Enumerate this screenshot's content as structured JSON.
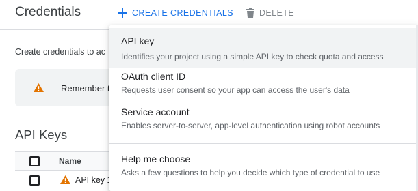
{
  "header": {
    "title": "Credentials",
    "create_label": "CREATE CREDENTIALS",
    "delete_label": "DELETE"
  },
  "intro": {
    "text": "Create credentials to ac"
  },
  "banner": {
    "text": "Remember t"
  },
  "api_keys": {
    "title": "API Keys",
    "column_name": "Name",
    "rows": [
      {
        "name": "API key 1"
      }
    ]
  },
  "menu": {
    "items": [
      {
        "label": "API key",
        "description": "Identifies your project using a simple API key to check quota and access"
      },
      {
        "label": "OAuth client ID",
        "description": "Requests user consent so your app can access the user's data"
      },
      {
        "label": "Service account",
        "description": "Enables server-to-server, app-level authentication using robot accounts"
      },
      {
        "label": "Help me choose",
        "description": "Asks a few questions to help you decide which type of credential to use"
      }
    ]
  },
  "colors": {
    "accent": "#1a73e8",
    "warning": "#e37400",
    "hover": "#f1f3f4"
  }
}
